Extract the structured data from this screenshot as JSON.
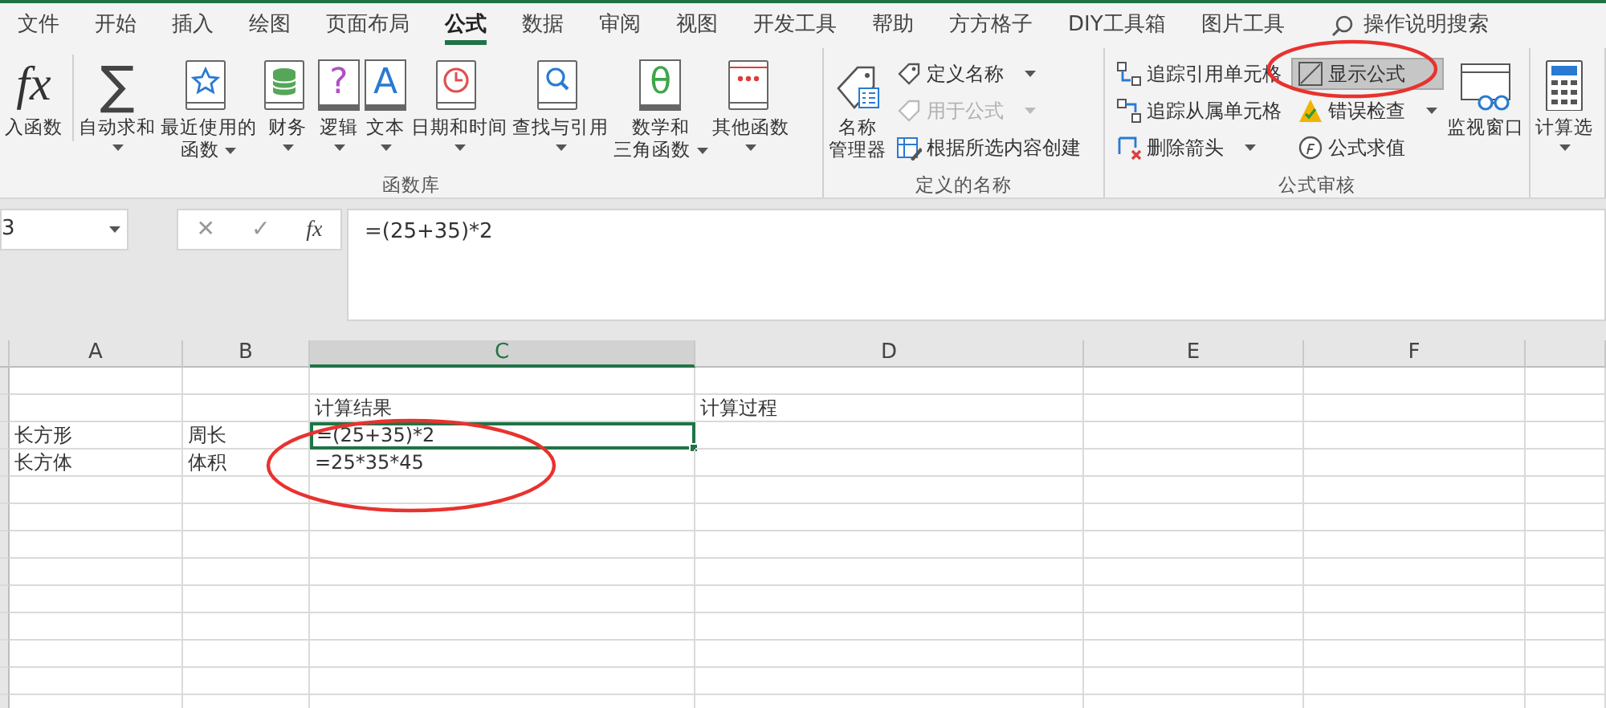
{
  "tabs": [
    {
      "label": "文件",
      "selected": false
    },
    {
      "label": "开始",
      "selected": false
    },
    {
      "label": "插入",
      "selected": false
    },
    {
      "label": "绘图",
      "selected": false
    },
    {
      "label": "页面布局",
      "selected": false
    },
    {
      "label": "公式",
      "selected": true
    },
    {
      "label": "数据",
      "selected": false
    },
    {
      "label": "审阅",
      "selected": false
    },
    {
      "label": "视图",
      "selected": false
    },
    {
      "label": "开发工具",
      "selected": false
    },
    {
      "label": "帮助",
      "selected": false
    },
    {
      "label": "方方格子",
      "selected": false
    },
    {
      "label": "DIY工具箱",
      "selected": false
    },
    {
      "label": "图片工具",
      "selected": false
    }
  ],
  "tell_me": {
    "label": "操作说明搜索"
  },
  "ribbon": [
    {
      "label": "函数库",
      "items": [
        {
          "kind": "large",
          "lines": [
            "入函数"
          ],
          "glyph": "fx",
          "dropdown": false
        },
        {
          "kind": "large",
          "lines": [
            "自动求和"
          ],
          "glyph": "∑",
          "dropdown": true
        },
        {
          "kind": "large",
          "lines": [
            "最近使用的",
            "函数"
          ],
          "dropdown": true
        },
        {
          "kind": "large",
          "lines": [
            "财务"
          ],
          "dropdown": true
        },
        {
          "kind": "large",
          "lines": [
            "逻辑"
          ],
          "glyph": "?",
          "dropdown": true
        },
        {
          "kind": "large",
          "lines": [
            "文本"
          ],
          "glyph": "A",
          "dropdown": true
        },
        {
          "kind": "large",
          "lines": [
            "日期和时间"
          ],
          "dropdown": true
        },
        {
          "kind": "large",
          "lines": [
            "查找与引用"
          ],
          "dropdown": true
        },
        {
          "kind": "large",
          "lines": [
            "数学和",
            "三角函数"
          ],
          "glyph": "θ",
          "dropdown": true
        },
        {
          "kind": "large",
          "lines": [
            "其他函数"
          ],
          "dropdown": true
        }
      ]
    },
    {
      "label": "定义的名称",
      "items": [
        {
          "kind": "large",
          "lines": [
            "名称",
            "管理器"
          ],
          "dropdown": false
        },
        {
          "kind": "stack",
          "buttons": [
            {
              "label": "定义名称",
              "dropdown": true,
              "disabled": false,
              "pressed": false
            },
            {
              "label": "用于公式",
              "dropdown": true,
              "disabled": true,
              "pressed": false
            },
            {
              "label": "根据所选内容创建",
              "dropdown": false,
              "disabled": false,
              "pressed": false
            }
          ]
        }
      ]
    },
    {
      "label": "公式审核",
      "items": [
        {
          "kind": "stack",
          "buttons": [
            {
              "label": "追踪引用单元格",
              "dropdown": false,
              "disabled": false,
              "pressed": false
            },
            {
              "label": "追踪从属单元格",
              "dropdown": false,
              "disabled": false,
              "pressed": false
            },
            {
              "label": "删除箭头",
              "dropdown": true,
              "disabled": false,
              "pressed": false
            }
          ]
        },
        {
          "kind": "stack",
          "buttons": [
            {
              "label": "显示公式",
              "dropdown": false,
              "disabled": false,
              "pressed": true
            },
            {
              "label": "错误检查",
              "dropdown": true,
              "disabled": false,
              "pressed": false
            },
            {
              "label": "公式求值",
              "dropdown": false,
              "disabled": false,
              "pressed": false
            }
          ]
        },
        {
          "kind": "large",
          "lines": [
            "监视窗口"
          ],
          "dropdown": false
        }
      ]
    },
    {
      "items": [
        {
          "kind": "large",
          "lines": [
            "计算选"
          ],
          "dropdown": true
        }
      ]
    }
  ],
  "formula_bar": {
    "name_box": "3",
    "cancel": "✕",
    "enter": "✓",
    "fx": "fx",
    "formula": "=(25+35)*2"
  },
  "columns": [
    {
      "label": "A",
      "selected": false
    },
    {
      "label": "B",
      "selected": false
    },
    {
      "label": "C",
      "selected": true
    },
    {
      "label": "D",
      "selected": false
    },
    {
      "label": "E",
      "selected": false
    },
    {
      "label": "F",
      "selected": false
    }
  ],
  "rows": [
    {
      "cells": {
        "c": {
          "text": "计算结果",
          "selected": false
        },
        "d": {
          "text": "计算过程",
          "selected": false
        }
      }
    },
    {
      "cells": {
        "a": {
          "text": "长方形",
          "selected": false
        },
        "b": {
          "text": "周长",
          "selected": false
        },
        "c": {
          "text": "=(25+35)*2",
          "selected": true
        }
      }
    },
    {
      "cells": {
        "a": {
          "text": "长方体",
          "selected": false
        },
        "b": {
          "text": "体积",
          "selected": false
        },
        "c": {
          "text": "=25*35*45",
          "selected": false
        }
      }
    }
  ],
  "annotations": [
    {
      "kind": "ellipse"
    },
    {
      "kind": "ellipse"
    }
  ]
}
